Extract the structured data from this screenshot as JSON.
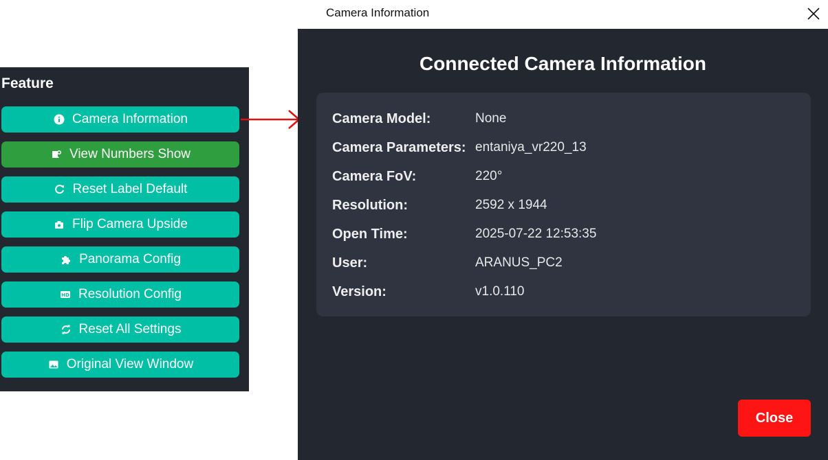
{
  "feature": {
    "title": "Feature",
    "buttons": [
      {
        "label": "Camera Information",
        "icon": "info-icon"
      },
      {
        "label": "View Numbers Show",
        "icon": "image-tag-icon"
      },
      {
        "label": "Reset Label Default",
        "icon": "refresh-icon"
      },
      {
        "label": "Flip Camera Upside",
        "icon": "camera-flip-icon"
      },
      {
        "label": "Panorama Config",
        "icon": "puzzle-icon"
      },
      {
        "label": "Resolution Config",
        "icon": "hd-icon"
      },
      {
        "label": "Reset All Settings",
        "icon": "sync-icon"
      },
      {
        "label": "Original View Window",
        "icon": "image-icon"
      }
    ],
    "active_index": 1
  },
  "dialog": {
    "window_title": "Camera Information",
    "heading": "Connected Camera Information",
    "fields": [
      {
        "label": "Camera Model:",
        "value": "None"
      },
      {
        "label": "Camera Parameters:",
        "value": "entaniya_vr220_13"
      },
      {
        "label": "Camera FoV:",
        "value": "220°"
      },
      {
        "label": "Resolution:",
        "value": "2592 x 1944"
      },
      {
        "label": "Open Time:",
        "value": "2025-07-22 12:53:35"
      },
      {
        "label": "User:",
        "value": "ARANUS_PC2"
      },
      {
        "label": "Version:",
        "value": "v1.0.110"
      }
    ],
    "close_label": "Close"
  },
  "colors": {
    "panel_bg": "#222730",
    "button_teal": "#00bfa5",
    "button_active_green": "#2e9e3e",
    "card_bg": "#2f3440",
    "close_red": "#ff1414",
    "arrow_red": "#e01010"
  }
}
